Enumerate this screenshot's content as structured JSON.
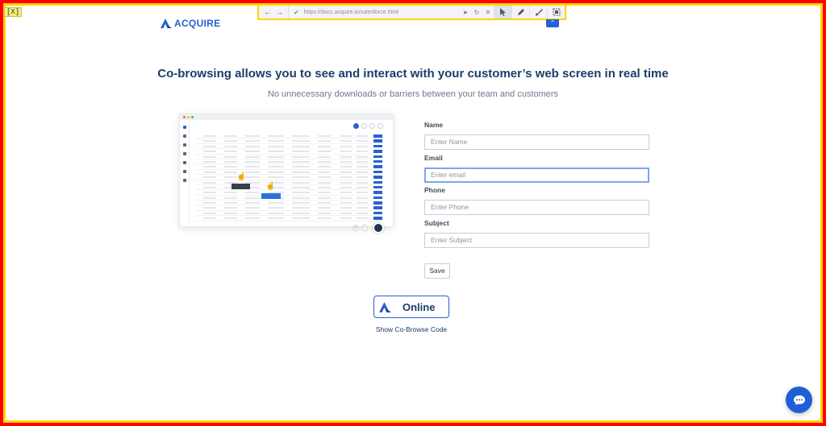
{
  "overlay_tag": "[X]",
  "cobrowse_toolbar": {
    "url": "https://docs.acquire.io/salesforce.html",
    "icons": [
      "arrow-left-icon",
      "arrow-right-icon",
      "check-icon",
      "locate-icon",
      "reload-icon",
      "close-icon",
      "pointer-icon",
      "pen-icon",
      "brush-icon",
      "screenshot-icon"
    ],
    "collapse_icon": "chevron-up-icon"
  },
  "brand": {
    "name": "ACQUIRE",
    "color": "#2a5fcf"
  },
  "hero": {
    "headline": "Co-browsing allows you to see and interact with your customer’s web screen in real time",
    "subheadline": "No unnecessary downloads or barriers between your team and customers"
  },
  "form": {
    "name_label": "Name",
    "name_placeholder": "Enter Name",
    "email_label": "Email",
    "email_placeholder": "Enter email",
    "phone_label": "Phone",
    "phone_placeholder": "Enter Phone",
    "subject_label": "Subject",
    "subject_placeholder": "Enter Subject",
    "save_label": "Save"
  },
  "status": {
    "label": "Online"
  },
  "show_code_link": "Show Co-Browse Code",
  "chat_icon": "chat-bubble-icon",
  "colors": {
    "accent": "#2a5fcf",
    "heading": "#1c3c6d",
    "frame": "#ff0000",
    "frame_inner": "#ffd400"
  }
}
